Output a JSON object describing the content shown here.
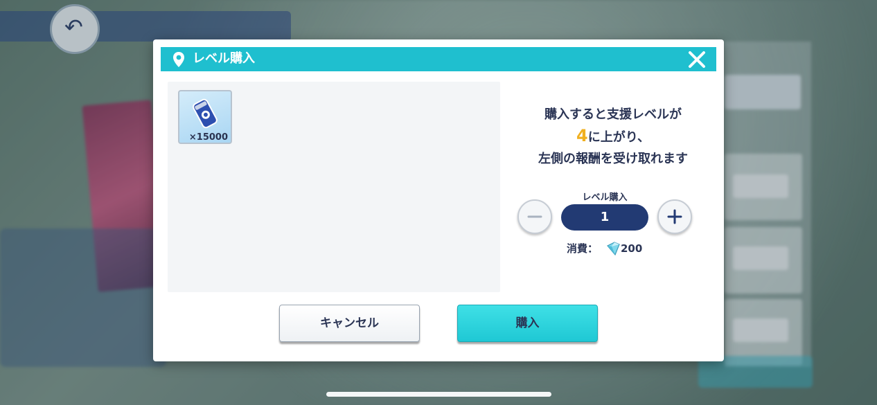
{
  "dialog": {
    "title": "レベル購入",
    "close_icon": "close-icon",
    "description_line1": "購入すると支援レベルが",
    "description_level": "4",
    "description_line2_suffix": "に上がり、",
    "description_line3": "左側の報酬を受け取れます",
    "quantity_label": "レベル購入",
    "quantity_value": "1",
    "cost_label": "消費：",
    "cost_value": "200",
    "cancel_label": "キャンセル",
    "buy_label": "購入"
  },
  "reward_items": [
    {
      "icon": "can-icon",
      "quantity": "×15000"
    }
  ],
  "colors": {
    "title_bar": "#1fbfcf",
    "accent_number": "#f0b020",
    "quantity_field": "#223a73",
    "buy_button": "#2fd3dc",
    "text": "#2b3555"
  }
}
